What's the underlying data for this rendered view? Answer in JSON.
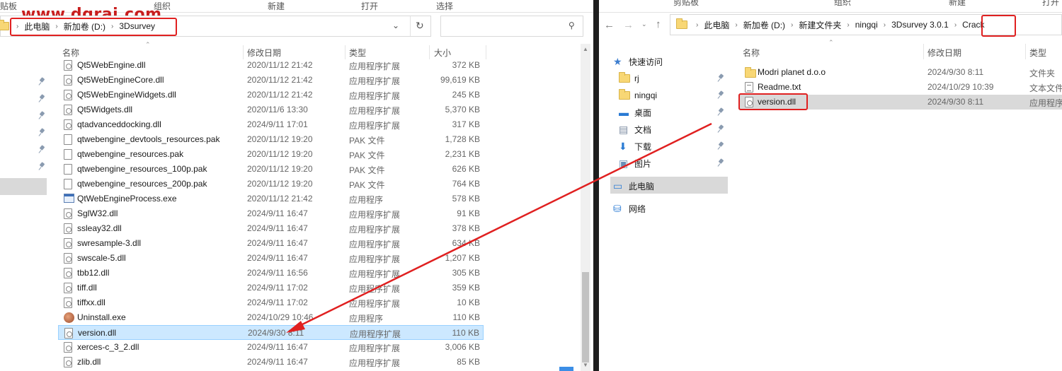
{
  "watermark": "www.dgrai.com",
  "left": {
    "ribbon": [
      "贴板",
      "组织",
      "新建",
      "打开",
      "选择"
    ],
    "breadcrumb": [
      "此电脑",
      "新加卷 (D:)",
      "3Dsurvey"
    ],
    "columns": {
      "name": "名称",
      "date": "修改日期",
      "type": "类型",
      "size": "大小"
    },
    "files": [
      {
        "name": "Qt5WebEngine.dll",
        "date": "2020/11/12 21:42",
        "type": "应用程序扩展",
        "size": "372 KB",
        "icon": "gear-file"
      },
      {
        "name": "Qt5WebEngineCore.dll",
        "date": "2020/11/12 21:42",
        "type": "应用程序扩展",
        "size": "99,619 KB",
        "icon": "gear-file"
      },
      {
        "name": "Qt5WebEngineWidgets.dll",
        "date": "2020/11/12 21:42",
        "type": "应用程序扩展",
        "size": "245 KB",
        "icon": "gear-file"
      },
      {
        "name": "Qt5Widgets.dll",
        "date": "2020/11/6 13:30",
        "type": "应用程序扩展",
        "size": "5,370 KB",
        "icon": "gear-file"
      },
      {
        "name": "qtadvanceddocking.dll",
        "date": "2024/9/11 17:01",
        "type": "应用程序扩展",
        "size": "317 KB",
        "icon": "gear-file"
      },
      {
        "name": "qtwebengine_devtools_resources.pak",
        "date": "2020/11/12 19:20",
        "type": "PAK 文件",
        "size": "1,728 KB",
        "icon": "blank-file"
      },
      {
        "name": "qtwebengine_resources.pak",
        "date": "2020/11/12 19:20",
        "type": "PAK 文件",
        "size": "2,231 KB",
        "icon": "blank-file"
      },
      {
        "name": "qtwebengine_resources_100p.pak",
        "date": "2020/11/12 19:20",
        "type": "PAK 文件",
        "size": "626 KB",
        "icon": "blank-file"
      },
      {
        "name": "qtwebengine_resources_200p.pak",
        "date": "2020/11/12 19:20",
        "type": "PAK 文件",
        "size": "764 KB",
        "icon": "blank-file"
      },
      {
        "name": "QtWebEngineProcess.exe",
        "date": "2020/11/12 21:42",
        "type": "应用程序",
        "size": "578 KB",
        "icon": "exe"
      },
      {
        "name": "SglW32.dll",
        "date": "2024/9/11 16:47",
        "type": "应用程序扩展",
        "size": "91 KB",
        "icon": "gear-file"
      },
      {
        "name": "ssleay32.dll",
        "date": "2024/9/11 16:47",
        "type": "应用程序扩展",
        "size": "378 KB",
        "icon": "gear-file"
      },
      {
        "name": "swresample-3.dll",
        "date": "2024/9/11 16:47",
        "type": "应用程序扩展",
        "size": "634 KB",
        "icon": "gear-file"
      },
      {
        "name": "swscale-5.dll",
        "date": "2024/9/11 16:47",
        "type": "应用程序扩展",
        "size": "1,207 KB",
        "icon": "gear-file"
      },
      {
        "name": "tbb12.dll",
        "date": "2024/9/11 16:56",
        "type": "应用程序扩展",
        "size": "305 KB",
        "icon": "gear-file"
      },
      {
        "name": "tiff.dll",
        "date": "2024/9/11 17:02",
        "type": "应用程序扩展",
        "size": "359 KB",
        "icon": "gear-file"
      },
      {
        "name": "tiffxx.dll",
        "date": "2024/9/11 17:02",
        "type": "应用程序扩展",
        "size": "10 KB",
        "icon": "gear-file"
      },
      {
        "name": "Uninstall.exe",
        "date": "2024/10/29 10:46",
        "type": "应用程序",
        "size": "110 KB",
        "icon": "uninstall"
      },
      {
        "name": "version.dll",
        "date": "2024/9/30 8:11",
        "type": "应用程序扩展",
        "size": "110 KB",
        "icon": "gear-file",
        "selected": true
      },
      {
        "name": "xerces-c_3_2.dll",
        "date": "2024/9/11 16:47",
        "type": "应用程序扩展",
        "size": "3,006 KB",
        "icon": "gear-file"
      },
      {
        "name": "zlib.dll",
        "date": "2024/9/11 16:47",
        "type": "应用程序扩展",
        "size": "85 KB",
        "icon": "gear-file"
      }
    ]
  },
  "right": {
    "ribbon": [
      "剪贴板",
      "组织",
      "新建",
      "打开"
    ],
    "breadcrumb": [
      "此电脑",
      "新加卷 (D:)",
      "新建文件夹",
      "ningqi",
      "3Dsurvey 3.0.1",
      "Crack"
    ],
    "columns": {
      "name": "名称",
      "date": "修改日期",
      "type": "类型"
    },
    "nav": [
      {
        "label": "快速访问",
        "icon": "star"
      },
      {
        "label": "rj",
        "icon": "folder"
      },
      {
        "label": "ningqi",
        "icon": "folder"
      },
      {
        "label": "桌面",
        "icon": "desktop"
      },
      {
        "label": "文档",
        "icon": "document"
      },
      {
        "label": "下载",
        "icon": "download"
      },
      {
        "label": "图片",
        "icon": "pictures"
      },
      {
        "label": "此电脑",
        "icon": "computer"
      },
      {
        "label": "网络",
        "icon": "network"
      }
    ],
    "files": [
      {
        "name": "Modri planet d.o.o",
        "date": "2024/9/30 8:11",
        "type": "文件夹",
        "icon": "folder"
      },
      {
        "name": "Readme.txt",
        "date": "2024/10/29 10:39",
        "type": "文本文件",
        "icon": "txt-file"
      },
      {
        "name": "version.dll",
        "date": "2024/9/30 8:11",
        "type": "应用程序",
        "icon": "gear-file",
        "selected": true
      }
    ]
  },
  "colors": {
    "annotation": "#e02020",
    "selection": "#cce8ff",
    "nav_selection": "#d9d9d9"
  }
}
